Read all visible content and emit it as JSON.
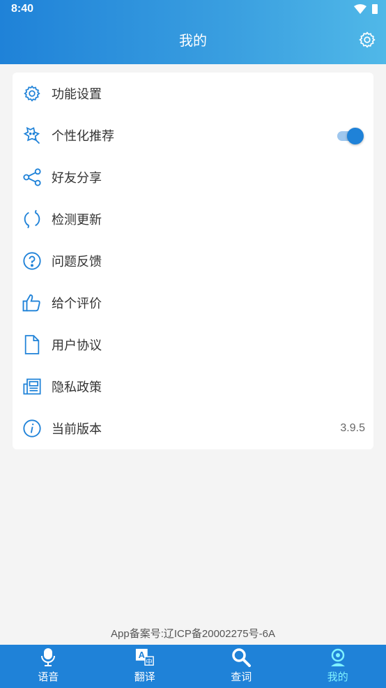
{
  "status_bar": {
    "time": "8:40"
  },
  "header": {
    "title": "我的"
  },
  "menu": [
    {
      "label": "功能设置",
      "icon": "gear-icon"
    },
    {
      "label": "个性化推荐",
      "icon": "personalize-icon",
      "toggle_on": true
    },
    {
      "label": "好友分享",
      "icon": "share-icon"
    },
    {
      "label": "检测更新",
      "icon": "refresh-icon"
    },
    {
      "label": "问题反馈",
      "icon": "question-icon"
    },
    {
      "label": "给个评价",
      "icon": "thumbs-up-icon"
    },
    {
      "label": "用户协议",
      "icon": "document-icon"
    },
    {
      "label": "隐私政策",
      "icon": "newspaper-icon"
    },
    {
      "label": "当前版本",
      "icon": "info-icon",
      "value": "3.9.5"
    }
  ],
  "footer": {
    "record_number": "App备案号:辽ICP备20002275号-6A"
  },
  "tabs": [
    {
      "label": "语音",
      "icon": "microphone-icon"
    },
    {
      "label": "翻译",
      "icon": "translate-icon"
    },
    {
      "label": "查词",
      "icon": "search-icon"
    },
    {
      "label": "我的",
      "icon": "profile-icon",
      "active": true
    }
  ],
  "colors": {
    "primary": "#1f82d8",
    "active_tab": "#7ff2ff"
  }
}
